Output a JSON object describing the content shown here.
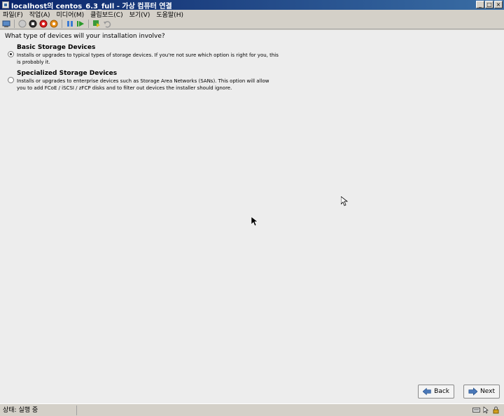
{
  "window": {
    "title": "localhost의 centos_6.3_full - 가상 컴퓨터 연결",
    "controls": [
      "_",
      "□",
      "×"
    ]
  },
  "menu": [
    "파일(F)",
    "작업(A)",
    "미디어(M)",
    "클립보드(C)",
    "보기(V)",
    "도움말(H)"
  ],
  "toolbar_icons": [
    "ctrl-alt-del-icon",
    "start-icon",
    "turn-off-icon",
    "shutdown-icon",
    "save-icon",
    "pause-icon",
    "resume-icon",
    "snapshot-icon",
    "revert-icon"
  ],
  "installer": {
    "question": "What type of devices will your installation involve?",
    "options": [
      {
        "title": "Basic Storage Devices",
        "description": "Installs or upgrades to typical types of storage devices.  If you're not sure which option is right for you, this is probably it.",
        "selected": true
      },
      {
        "title": "Specialized Storage Devices",
        "description": "Installs or upgrades to enterprise devices such as Storage Area Networks (SANs). This option will allow you to add FCoE / iSCSI / zFCP disks and to filter out devices the installer should ignore.",
        "selected": false
      }
    ],
    "back_label": "Back",
    "next_label": "Next"
  },
  "status": {
    "text": "상태: 실행 중"
  },
  "colors": {
    "titlebar": "#0a246a",
    "guest_bg": "#ededed",
    "chrome": "#d4d0c8"
  }
}
